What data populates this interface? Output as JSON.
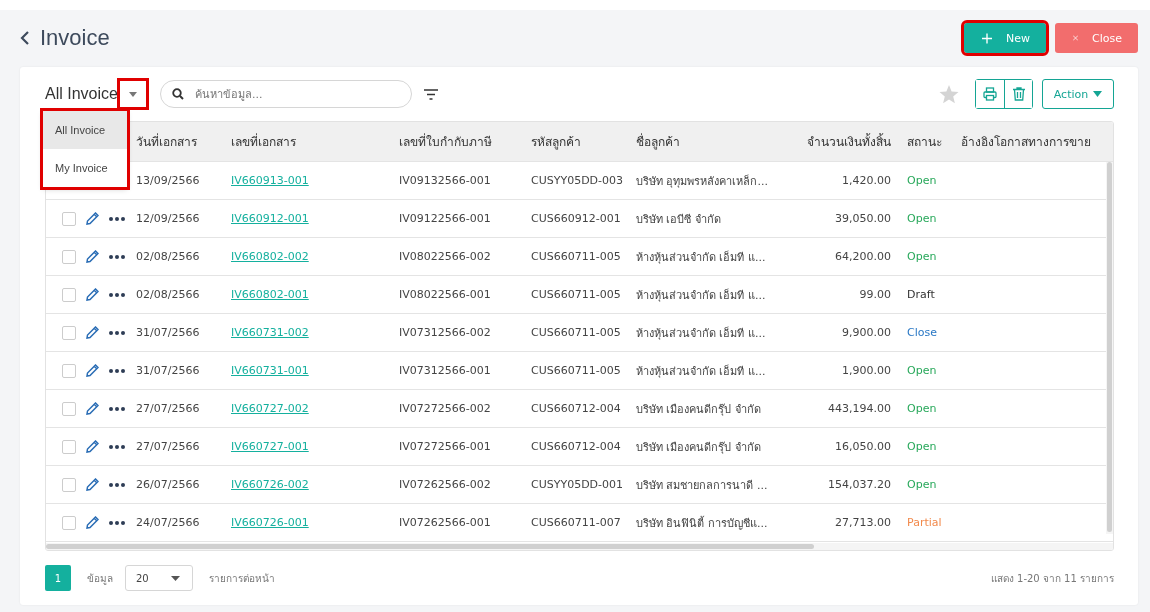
{
  "header": {
    "title": "Invoice",
    "new_button": {
      "label": "New",
      "highlighted": true
    },
    "close_button": {
      "label": "Close"
    }
  },
  "toolbar": {
    "view_label": "All Invoice",
    "view_toggle_highlighted": true,
    "search": {
      "placeholder": "ค้นหาข้อมูล..."
    },
    "action_button": "Action"
  },
  "view_menu": {
    "highlighted": true,
    "items": [
      {
        "label": "All Invoice",
        "selected": true
      },
      {
        "label": "My Invoice",
        "selected": false
      }
    ]
  },
  "table": {
    "columns": [
      "วันที่เอกสาร",
      "เลขที่เอกสาร",
      "เลขที่ใบกำกับภาษี",
      "รหัสลูกค้า",
      "ชื่อลูกค้า",
      "จำนวนเงินทั้งสิ้น",
      "สถานะ",
      "อ้างอิงโอกาสทางการขาย"
    ],
    "rows": [
      {
        "date": "13/09/2566",
        "doc_no": "IV660913-001",
        "tax_no": "IV09132566-001",
        "customer_code": "CUSYY05DD-003",
        "customer_name": "บริษัท อุทุมพรหลังคาเหล็ก...",
        "amount": "1,420.00",
        "status": "Open",
        "color": "#27a85a"
      },
      {
        "checked": false,
        "date": "12/09/2566",
        "doc_no": "IV660912-001",
        "tax_no": "IV09122566-001",
        "customer_code": "CUS660912-001",
        "customer_name": "บริษัท เอบีซี จำกัด",
        "amount": "39,050.00",
        "status": "Open",
        "color": "#27a85a"
      },
      {
        "checked": false,
        "date": "02/08/2566",
        "doc_no": "IV660802-002",
        "tax_no": "IV08022566-002",
        "customer_code": "CUS660711-005",
        "customer_name": "ห้างหุ้นส่วนจำกัด เอ็มที แ...",
        "amount": "64,200.00",
        "status": "Open",
        "color": "#27a85a"
      },
      {
        "checked": false,
        "date": "02/08/2566",
        "doc_no": "IV660802-001",
        "tax_no": "IV08022566-001",
        "customer_code": "CUS660711-005",
        "customer_name": "ห้างหุ้นส่วนจำกัด เอ็มที แ...",
        "amount": "99.00",
        "status": "Draft",
        "color": "#333333"
      },
      {
        "checked": false,
        "date": "31/07/2566",
        "doc_no": "IV660731-002",
        "tax_no": "IV07312566-002",
        "customer_code": "CUS660711-005",
        "customer_name": "ห้างหุ้นส่วนจำกัด เอ็มที แ...",
        "amount": "9,900.00",
        "status": "Close",
        "color": "#2a78c5"
      },
      {
        "checked": false,
        "date": "31/07/2566",
        "doc_no": "IV660731-001",
        "tax_no": "IV07312566-001",
        "customer_code": "CUS660711-005",
        "customer_name": "ห้างหุ้นส่วนจำกัด เอ็มที แ...",
        "amount": "1,900.00",
        "status": "Open",
        "color": "#27a85a"
      },
      {
        "checked": false,
        "date": "27/07/2566",
        "doc_no": "IV660727-002",
        "tax_no": "IV07272566-002",
        "customer_code": "CUS660712-004",
        "customer_name": "บริษัท เมืองคนดีกรุ๊ป จำกัด",
        "amount": "443,194.00",
        "status": "Open",
        "color": "#27a85a"
      },
      {
        "checked": false,
        "date": "27/07/2566",
        "doc_no": "IV660727-001",
        "tax_no": "IV07272566-001",
        "customer_code": "CUS660712-004",
        "customer_name": "บริษัท เมืองคนดีกรุ๊ป จำกัด",
        "amount": "16,050.00",
        "status": "Open",
        "color": "#27a85a"
      },
      {
        "checked": false,
        "date": "26/07/2566",
        "doc_no": "IV660726-002",
        "tax_no": "IV07262566-002",
        "customer_code": "CUSYY05DD-001",
        "customer_name": "บริษัท สมชายกลการนาดี ...",
        "amount": "154,037.20",
        "status": "Open",
        "color": "#27a85a"
      },
      {
        "checked": false,
        "date": "24/07/2566",
        "doc_no": "IV660726-001",
        "tax_no": "IV07262566-001",
        "customer_code": "CUS660711-007",
        "customer_name": "บริษัท อินฟินิตี้ การบัญชีแ...",
        "amount": "27,713.00",
        "status": "Partial",
        "color": "#f28a4c"
      }
    ]
  },
  "pagination": {
    "page": "1",
    "data_label": "ข้อมูล",
    "page_size": "20",
    "per_page_label": "รายการต่อหน้า",
    "summary": "แสดง 1-20 จาก 11 รายการ"
  }
}
